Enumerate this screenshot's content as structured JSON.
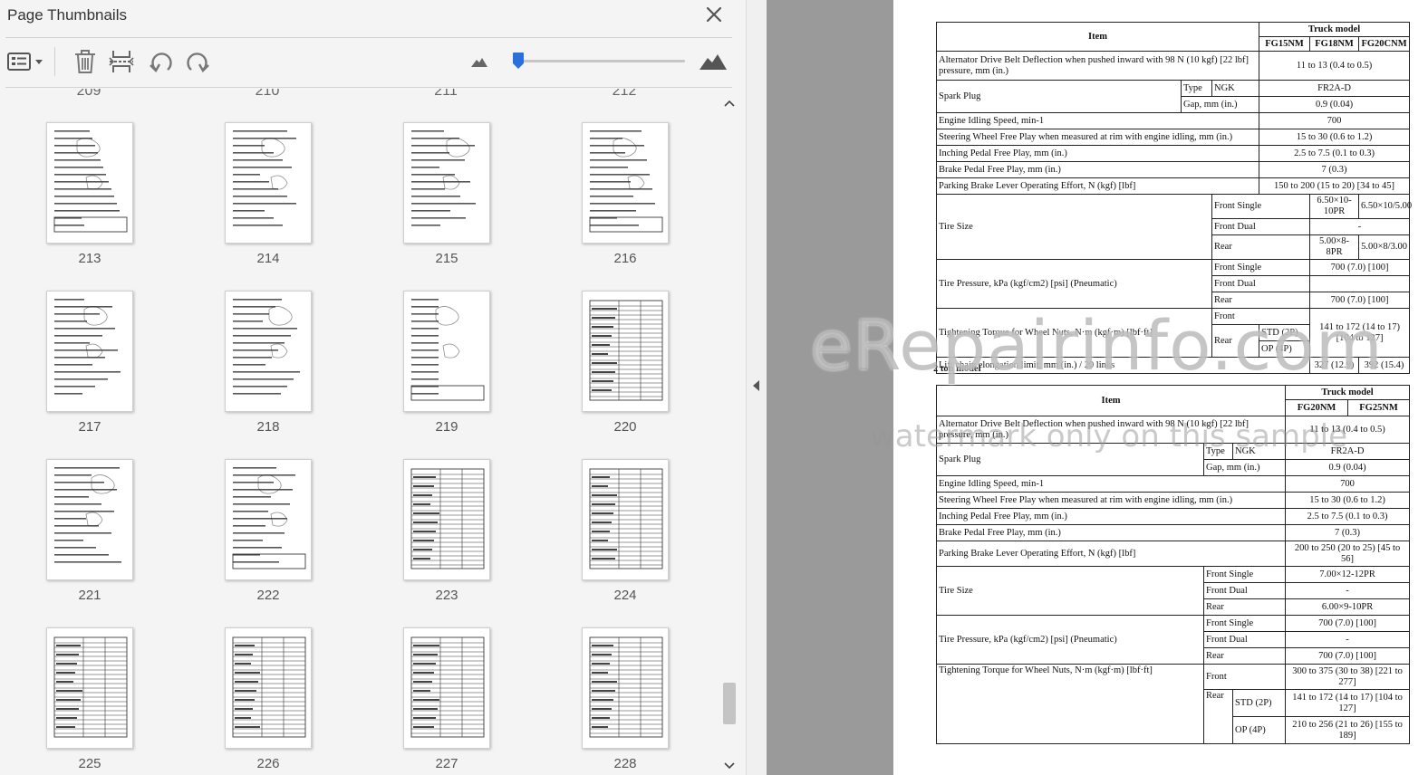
{
  "panel": {
    "title": "Page Thumbnails",
    "close_icon": "close-icon",
    "toolbar": [
      {
        "name": "options-menu-button",
        "icon": "list-options-icon"
      },
      {
        "name": "delete-page-button",
        "icon": "trash-icon"
      },
      {
        "name": "insert-page-button",
        "icon": "insert-pages-icon"
      },
      {
        "name": "rotate-left-button",
        "icon": "rotate-ccw-icon"
      },
      {
        "name": "rotate-right-button",
        "icon": "rotate-cw-icon"
      }
    ],
    "zoom": {
      "small_icon": "mountain-small-icon",
      "large_icon": "mountain-large-icon",
      "level": 0.02
    },
    "cut_labels": [
      "209",
      "210",
      "211",
      "212"
    ],
    "pages": [
      "213",
      "214",
      "215",
      "216",
      "217",
      "218",
      "219",
      "220",
      "221",
      "222",
      "223",
      "224",
      "225",
      "226",
      "227",
      "228"
    ]
  },
  "accent": "#7a9fd6",
  "collapse_icon": "triangle-left-icon",
  "document": {
    "table1": {
      "header_item": "Item",
      "header_truck": "Truck model",
      "models": [
        "FG15NM",
        "FG18NM",
        "FG20CNM"
      ],
      "alternator": {
        "label": "Alternator Drive Belt Deflection when pushed inward with 98 N (10 kgf) [22 lbf] pressure, mm (in.)",
        "value": "11 to 13 (0.4 to 0.5)"
      },
      "spark": {
        "label": "Spark Plug",
        "type": "Type",
        "type_val": "NGK",
        "type_value": "FR2A-D",
        "gap": "Gap, mm (in.)",
        "gap_value": "0.9 (0.04)"
      },
      "idle": {
        "label": "Engine Idling Speed, min-1",
        "value": "700"
      },
      "steering": {
        "label": "Steering Wheel Free Play when measured at rim with engine idling, mm (in.)",
        "value": "15 to 30 (0.6 to 1.2)"
      },
      "inching": {
        "label": "Inching Pedal Free Play, mm (in.)",
        "value": "2.5 to 7.5 (0.1 to 0.3)"
      },
      "brake": {
        "label": "Brake Pedal Free Play, mm (in.)",
        "value": "7 (0.3)"
      },
      "parking": {
        "label": "Parking Brake Lever Operating Effort, N (kgf) [lbf]",
        "value": "150 to 200 (15 to 20) [34 to 45]"
      },
      "tire": {
        "label": "Tire Size",
        "front_single": "Front Single",
        "fs_a": "6.50×10-10PR",
        "fs_b": "6.50×10/5.00",
        "front_dual": "Front Dual",
        "fd": "-",
        "rear": "Rear",
        "r_a": "5.00×8-8PR",
        "r_b": "5.00×8/3.00"
      },
      "pressure": {
        "label": "Tire Pressure, kPa (kgf/cm2) [psi] (Pneumatic)",
        "front_single": "Front Single",
        "fs": "700 (7.0) [100]",
        "front_dual": "Front Dual",
        "fd": "",
        "rear": "Rear",
        "r": "700 (7.0) [100]"
      },
      "torque": {
        "label": "Tightening Torque for Wheel Nuts, N·m (kgf·m) [lbf·ft]",
        "front": "Front",
        "rear": "Rear",
        "std": "STD (2P)",
        "op": "OP (4P)",
        "value": "141 to 172 (14 to 17) [104 to 127]"
      },
      "lift": {
        "label": "Lift chain elongation limit, mm (in.) / 20 links",
        "a": "327 (12.9)",
        "b": "392 (15.4)"
      }
    },
    "section2": "2 ton model",
    "table2": {
      "header_item": "Item",
      "header_truck": "Truck model",
      "models": [
        "FG20NM",
        "FG25NM"
      ],
      "alternator": {
        "label": "Alternator Drive Belt Deflection when pushed inward with 98 N (10 kgf) [22 lbf] pressure, mm (in.)",
        "value": "11 to 13 (0.4 to 0.5)"
      },
      "spark": {
        "label": "Spark Plug",
        "type": "Type",
        "type_val": "NGK",
        "type_value": "FR2A-D",
        "gap": "Gap, mm (in.)",
        "gap_value": "0.9 (0.04)"
      },
      "idle": {
        "label": "Engine Idling Speed, min-1",
        "value": "700"
      },
      "steering": {
        "label": "Steering Wheel Free Play when measured at rim with engine idling, mm (in.)",
        "value": "15 to 30 (0.6 to 1.2)"
      },
      "inching": {
        "label": "Inching Pedal Free Play, mm (in.)",
        "value": "2.5 to 7.5 (0.1 to 0.3)"
      },
      "brake": {
        "label": "Brake Pedal Free Play, mm (in.)",
        "value": "7 (0.3)"
      },
      "parking": {
        "label": "Parking Brake Lever Operating Effort, N (kgf) [lbf]",
        "value": "200 to 250 (20 to 25) [45 to 56]"
      },
      "tire": {
        "label": "Tire Size",
        "front_single": "Front Single",
        "fs": "7.00×12-12PR",
        "front_dual": "Front Dual",
        "fd": "-",
        "rear": "Rear",
        "r": "6.00×9-10PR"
      },
      "pressure": {
        "label": "Tire Pressure, kPa (kgf/cm2) [psi] (Pneumatic)",
        "front_single": "Front Single",
        "fs": "700 (7.0) [100]",
        "front_dual": "Front Dual",
        "fd": "-",
        "rear": "Rear",
        "r": "700 (7.0) [100]"
      },
      "torque": {
        "label": "Tightening Torque for Wheel Nuts, N·m (kgf·m) [lbf·ft]",
        "front": "Front",
        "front_value": "300 to 375 (30 to 38) [221 to 277]",
        "rear": "Rear",
        "std": "STD (2P)",
        "std_value": "141 to 172 (14 to 17) [104 to 127]",
        "op": "OP (4P)",
        "op_value": "210 to 256 (21 to 26) [155 to 189]"
      }
    },
    "watermark": "eRepairinfo.com",
    "watermark_sub": "watermark only on this sample"
  }
}
